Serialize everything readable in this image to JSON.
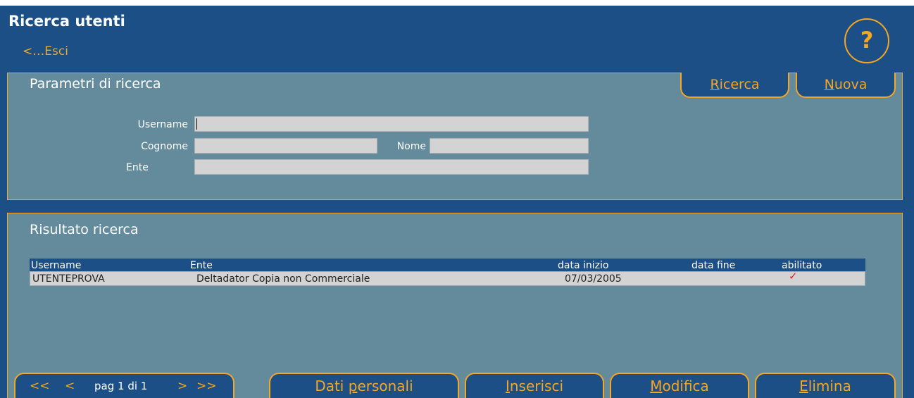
{
  "window": {
    "title": "Ricerca utenti",
    "exit_link": "<…Esci",
    "help_label": "?"
  },
  "search": {
    "title": "Parametri di ricerca",
    "tabs": [
      {
        "accesskey": "R",
        "rest": "icerca"
      },
      {
        "accesskey": "N",
        "rest": "uova"
      }
    ],
    "fields": {
      "username": {
        "label": "Username",
        "value": ""
      },
      "cognome": {
        "label": "Cognome",
        "value": ""
      },
      "nome": {
        "label": "Nome",
        "value": ""
      },
      "ente": {
        "label": "Ente",
        "value": ""
      }
    }
  },
  "results": {
    "title": "Risultato ricerca",
    "columns": [
      "Username",
      "Ente",
      "data inizio",
      "data fine",
      "abilitato"
    ],
    "rows": [
      {
        "username": "UTENTEPROVA",
        "ente": "Deltadator Copia non Commerciale",
        "data_inizio": "07/03/2005",
        "data_fine": "",
        "abilitato": "✓"
      }
    ]
  },
  "pager": {
    "first": "<<",
    "prev": "<",
    "info": "pag 1 di 1",
    "next": ">",
    "last": ">>"
  },
  "actions": {
    "dati_personali": {
      "before": "Dati ",
      "accesskey": "p",
      "after": "ersonali"
    },
    "inserisci": {
      "before": "",
      "accesskey": "I",
      "after": "nserisci"
    },
    "modifica": {
      "before": "",
      "accesskey": "M",
      "after": "odifica"
    },
    "elimina": {
      "before": "",
      "accesskey": "E",
      "after": "limina"
    }
  },
  "colors": {
    "header_blue": "#1b4f86",
    "panel": "#648b9c",
    "accent": "#f5a623",
    "check": "#e0231c"
  }
}
